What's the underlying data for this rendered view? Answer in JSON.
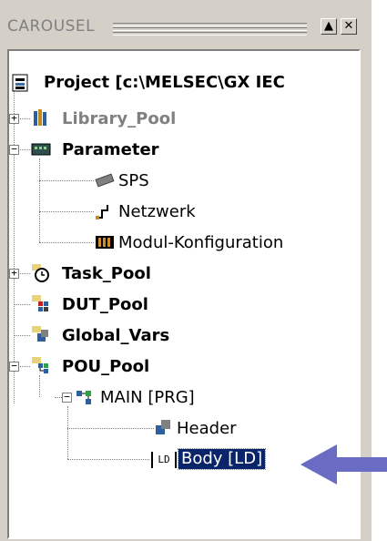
{
  "panel": {
    "title": "CAROUSEL",
    "buttons": {
      "minimize": "▲",
      "close": "✕"
    }
  },
  "tree": [
    {
      "label": "Project [c:\\MELSEC\\GX IEC",
      "bold": true,
      "icon": "project-icon",
      "expander": null
    },
    {
      "label": "Library_Pool",
      "bold": true,
      "grey": true,
      "icon": "library-books-icon",
      "expander": "+"
    },
    {
      "label": "Parameter",
      "bold": true,
      "icon": "parameter-icon",
      "expander": "−"
    },
    {
      "label": "SPS",
      "icon": "sps-chip-icon",
      "expander": null
    },
    {
      "label": "Netzwerk",
      "icon": "network-icon",
      "expander": null
    },
    {
      "label": "Modul-Konfiguration",
      "icon": "module-config-icon",
      "expander": null
    },
    {
      "label": "Task_Pool",
      "bold": true,
      "icon": "task-clock-icon",
      "expander": "+"
    },
    {
      "label": "DUT_Pool",
      "bold": true,
      "icon": "dut-pool-icon",
      "expander": null
    },
    {
      "label": "Global_Vars",
      "bold": true,
      "icon": "global-vars-icon",
      "expander": null
    },
    {
      "label": "POU_Pool",
      "bold": true,
      "icon": "pou-pool-icon",
      "expander": "−"
    },
    {
      "label": "MAIN [PRG]",
      "icon": "program-icon",
      "expander": "−"
    },
    {
      "label": "Header",
      "icon": "header-icon",
      "expander": null
    },
    {
      "label": "Body [LD]",
      "icon": "ladder-icon",
      "expander": null,
      "selected": true
    }
  ],
  "ladder_icon_text": "LD",
  "colors": {
    "panel": "#d4d0c8",
    "selection": "#0a246a",
    "arrow": "#6a6cc4"
  }
}
